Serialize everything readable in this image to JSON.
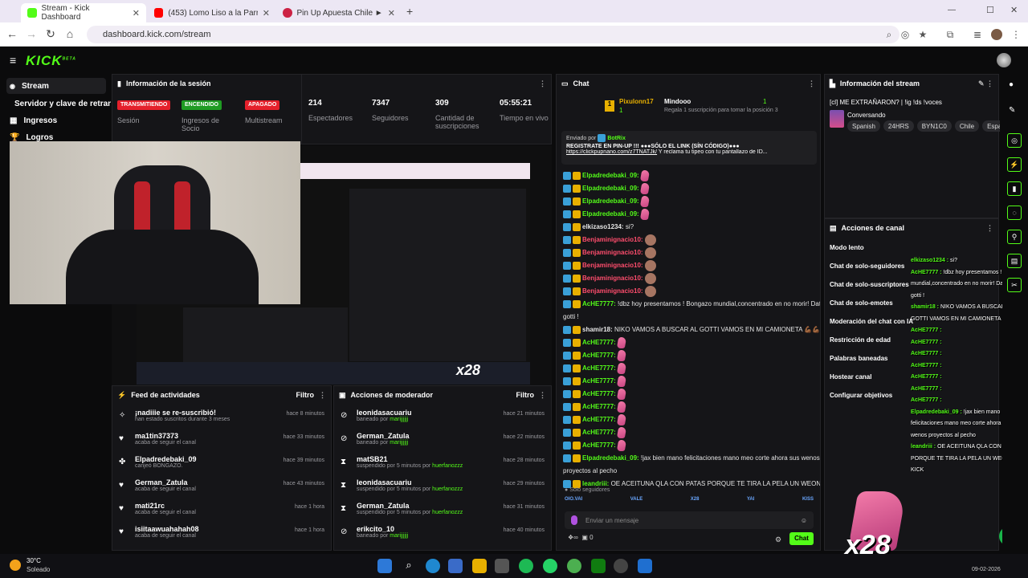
{
  "browser": {
    "tabs": [
      {
        "label": "Stream - Kick Dashboard",
        "color": "#53fc18"
      },
      {
        "label": "(453) Lomo Liso a la Parrilla - Y",
        "color": "#ff0000"
      },
      {
        "label": "Pin Up Apuesta Chile ► Libro D",
        "color": "#cc2244"
      }
    ],
    "new_tab": "+",
    "url": "dashboard.kick.com/stream",
    "win_min": "—",
    "win_max": "☐",
    "win_close": "✕"
  },
  "header": {
    "logo": "KICK",
    "logo_sup": "BETA",
    "menu_icon": "≡"
  },
  "sidebar": {
    "items": [
      {
        "label": "Stream"
      },
      {
        "label": "Servidor y clave de retransmisión"
      },
      {
        "label": "Ingresos"
      },
      {
        "label": "Logros"
      }
    ]
  },
  "session": {
    "title": "Información de la sesión",
    "statuses": [
      {
        "badge": "TRANSMITIENDO",
        "color": "#e5202b",
        "label": "Sesión"
      },
      {
        "badge": "ENCENDIDO",
        "color": "#1f9b23",
        "label": "Ingresos de Socio"
      },
      {
        "badge": "APAGADO",
        "color": "#e5202b",
        "label": "Multistream"
      }
    ],
    "stats": [
      {
        "value": "214",
        "label": "Espectadores"
      },
      {
        "value": "7347",
        "label": "Seguidores"
      },
      {
        "value": "309",
        "label": "Cantidad de suscripciones"
      },
      {
        "value": "05:55:21",
        "label": "Tiempo en vivo"
      }
    ]
  },
  "preview_overlay": "x28",
  "feed": {
    "title": "Feed de actividades",
    "filter": "Filtro",
    "items": [
      {
        "icon": "star",
        "main": "¡nadiiie se re-suscribió!",
        "sub": "han estado suscritos durante 3 meses",
        "time": "hace 8 minutos"
      },
      {
        "icon": "heart",
        "main": "ma1tin37373",
        "sub": "acaba de seguir el canal",
        "time": "hace 33 minutos"
      },
      {
        "icon": "kick",
        "main": "Elpadredebaki_09",
        "sub": "canjeó BONGAZO.",
        "time": "hace 39 minutos"
      },
      {
        "icon": "heart",
        "main": "German_Zatula",
        "sub": "acaba de seguir el canal",
        "time": "hace 43 minutos"
      },
      {
        "icon": "heart",
        "main": "mati21rc",
        "sub": "acaba de seguir el canal",
        "time": "hace 1 hora"
      },
      {
        "icon": "heart",
        "main": "isiitaawuahahah08",
        "sub": "acaba de seguir el canal",
        "time": "hace 1 hora"
      }
    ]
  },
  "mod": {
    "title": "Acciones de moderador",
    "filter": "Filtro",
    "items": [
      {
        "icon": "ban",
        "main": "leonidasacuariu",
        "sub": "baneado por",
        "by": "marijjjjjj",
        "time": "hace 21 minutos"
      },
      {
        "icon": "ban",
        "main": "German_Zatula",
        "sub": "baneado por",
        "by": "marijjjjjj",
        "time": "hace 22 minutos"
      },
      {
        "icon": "timeout",
        "main": "matSB21",
        "sub": "suspendido por 5 minutos por",
        "by": "huerfanozzz",
        "time": "hace 28 minutos"
      },
      {
        "icon": "timeout",
        "main": "leonidasacuariu",
        "sub": "suspendido por 5 minutos por",
        "by": "huerfanozzz",
        "time": "hace 29 minutos"
      },
      {
        "icon": "timeout",
        "main": "German_Zatula",
        "sub": "suspendido por 5 minutos por",
        "by": "huerfanozzz",
        "time": "hace 31 minutos"
      },
      {
        "icon": "ban",
        "main": "erikcito_10",
        "sub": "baneado por",
        "by": "marijjjjjj",
        "time": "hace 40 minutos"
      }
    ]
  },
  "chat": {
    "title": "Chat",
    "top_gifter": {
      "name": "Pixulonn17",
      "count": "1",
      "rank_badge": "1"
    },
    "top_gifter2": {
      "name": "Mindooo",
      "count": "1",
      "hint": "Regala 1 suscripción para tomar la posición 3"
    },
    "pinned": {
      "by_label": "Enviado por",
      "by": "BotRix",
      "line1": "REGISTRATE EN PIN-UP",
      "line1b": "!!! ●●●SÓLO EL LINK (SÍN CÓDIGO)●●●",
      "link": "https://clickpupnano.com/z7TNATJk/",
      "line2": "Y reclama tu tipeo con tu pantallazo de ID..."
    },
    "messages": [
      {
        "user": "Elpadredebaki_09",
        "text": "",
        "color": "#53fc18",
        "emote": "pink"
      },
      {
        "user": "Elpadredebaki_09",
        "text": "",
        "color": "#53fc18",
        "emote": "pink"
      },
      {
        "user": "Elpadredebaki_09",
        "text": "",
        "color": "#53fc18",
        "emote": "pink"
      },
      {
        "user": "Elpadredebaki_09",
        "text": "",
        "color": "#53fc18",
        "emote": "pink"
      },
      {
        "user": "elkizaso1234",
        "text": "si?",
        "color": "#e6e6e6",
        "emote": ""
      },
      {
        "user": "Benjaminignacio10",
        "text": "",
        "color": "#ff4d6d",
        "emote": "brown"
      },
      {
        "user": "Benjaminignacio10",
        "text": "",
        "color": "#ff4d6d",
        "emote": "brown"
      },
      {
        "user": "Benjaminignacio10",
        "text": "",
        "color": "#ff4d6d",
        "emote": "brown"
      },
      {
        "user": "Benjaminignacio10",
        "text": "",
        "color": "#ff4d6d",
        "emote": "brown"
      },
      {
        "user": "Benjaminignacio10",
        "text": "",
        "color": "#ff4d6d",
        "emote": "brown"
      },
      {
        "user": "AcHE7777",
        "text": "!dbz hoy presentamos ! Bongazo mundial,concentrado en no morir! Date prisa",
        "color": "#53fc18",
        "emote": ""
      },
      {
        "user": "",
        "text": "gotti !",
        "color": "#e6e6e6",
        "emote": ""
      },
      {
        "user": "shamir18",
        "text": "NIKO VAMOS A BUSCAR AL GOTTI VAMOS EN MI CAMIONETA 💪🏾💪🏾 ❤️ ❤️",
        "color": "#e6e6e6",
        "emote": ""
      },
      {
        "user": "AcHE7777",
        "text": "",
        "color": "#53fc18",
        "emote": "pink"
      },
      {
        "user": "AcHE7777",
        "text": "",
        "color": "#53fc18",
        "emote": "pink"
      },
      {
        "user": "AcHE7777",
        "text": "",
        "color": "#53fc18",
        "emote": "pink"
      },
      {
        "user": "AcHE7777",
        "text": "",
        "color": "#53fc18",
        "emote": "pink"
      },
      {
        "user": "AcHE7777",
        "text": "",
        "color": "#53fc18",
        "emote": "pink"
      },
      {
        "user": "AcHE7777",
        "text": "",
        "color": "#53fc18",
        "emote": "pink"
      },
      {
        "user": "AcHE7777",
        "text": "",
        "color": "#53fc18",
        "emote": "pink"
      },
      {
        "user": "AcHE7777",
        "text": "",
        "color": "#53fc18",
        "emote": "pink"
      },
      {
        "user": "AcHE7777",
        "text": "",
        "color": "#53fc18",
        "emote": "pink"
      },
      {
        "user": "Elpadredebaki_09",
        "text": "!jax bien mano felicitaciones mano meo corte ahora sus wenos",
        "color": "#53fc18",
        "emote": ""
      },
      {
        "user": "",
        "text": "proyectos al pecho",
        "color": "#e6e6e6",
        "emote": ""
      },
      {
        "user": "leandriii",
        "text": "OE ACEITUNA QLA CON PATAS PORQUE TE TIRA LA PELA UN WEON EN KICK",
        "color": "#53fc18",
        "emote": ""
      }
    ],
    "followers_only": "Solo seguidores",
    "emote_bar": [
      "OIO.VAI",
      "VALE",
      "X28",
      "YAI",
      "KISS"
    ],
    "input_placeholder": "Enviar un mensaje",
    "points": "0",
    "send": "Chat"
  },
  "stream_info": {
    "title": "Información del stream",
    "stream_title": "[cl] ME EXTRAÑARON? | !ig !ds !voces",
    "category": "Conversando",
    "tags": [
      "Spanish",
      "24HRS",
      "BYN1C0",
      "Chile",
      "Españo"
    ]
  },
  "actions": {
    "title": "Acciones de canal",
    "items": [
      "Modo lento",
      "Chat de solo-seguidores",
      "Chat de solo-suscriptores",
      "Chat de solo-emotes",
      "Moderación del chat con IA",
      "Restricción de edad",
      "Palabras baneadas",
      "Hostear canal",
      "Configurar objetivos"
    ]
  },
  "overlay": {
    "badge": "x28",
    "lines": [
      {
        "user": "elkizaso1234",
        "text": "si?"
      },
      {
        "user": "AcHE7777",
        "text": "!dbz hoy presentamos ! Bongazo mundial,concentrado en no morir! Date prisa gotti !"
      },
      {
        "user": "shamir18",
        "text": "NIKO VAMOS A BUSCAR AL GOTTI VAMOS EN MI CAMIONETA"
      },
      {
        "user": "AcHE7777",
        "text": ""
      },
      {
        "user": "AcHE7777",
        "text": ""
      },
      {
        "user": "AcHE7777",
        "text": ""
      },
      {
        "user": "AcHE7777",
        "text": ""
      },
      {
        "user": "AcHE7777",
        "text": ""
      },
      {
        "user": "AcHE7777",
        "text": ""
      },
      {
        "user": "AcHE7777",
        "text": ""
      },
      {
        "user": "Elpadredebaki_09",
        "text": "!jax bien mano felicitaciones mano meo corte ahora sus wenos proyectos al pecho"
      },
      {
        "user": "leandriii",
        "text": "OE ACEITUNA QLA CON PATAS PORQUE TE TIRA LA PELA UN WEON EN KICK"
      }
    ]
  },
  "taskbar": {
    "weather_temp": "30°C",
    "weather_desc": "Soleado",
    "date": "09-02-2026"
  }
}
